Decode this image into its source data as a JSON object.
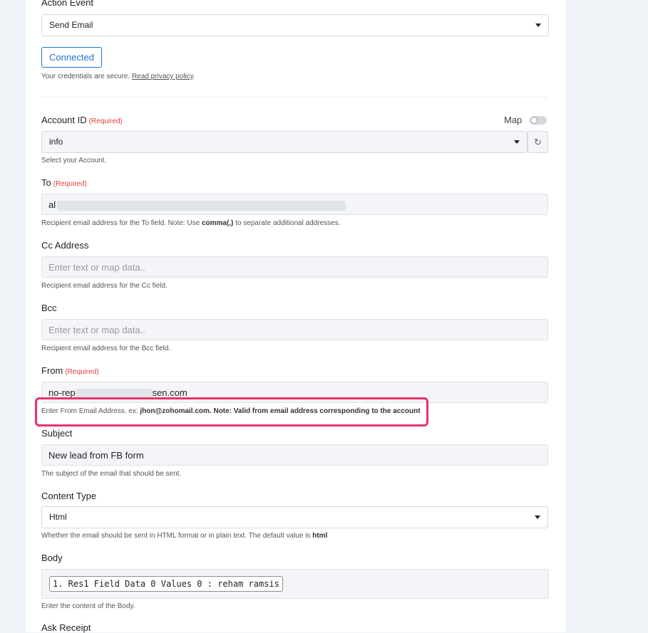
{
  "action_event": {
    "label": "Action Event",
    "value": "Send Email",
    "connected_label": "Connected",
    "credentials_text": "Your credentials are secure.",
    "privacy_link": "Read privacy policy",
    "period": "."
  },
  "account_id": {
    "label": "Account ID",
    "required": "(Required)",
    "map_label": "Map",
    "value": "info",
    "help": "Select your Account."
  },
  "to": {
    "label": "To",
    "required": "(Required)",
    "value": "al",
    "help_prefix": "Recipient email address for the To field. Note: Use",
    "help_bold": "comma(,)",
    "help_suffix": "to separate additional addresses."
  },
  "cc": {
    "label": "Cc Address",
    "placeholder": "Enter text or map data..",
    "help": "Recipient email address for the Cc field."
  },
  "bcc": {
    "label": "Bcc",
    "placeholder": "Enter text or map data..",
    "help": "Recipient email address for the Bcc field."
  },
  "from": {
    "label": "From",
    "required": "(Required)",
    "value_start": "no-rep",
    "value_end": "sen.com",
    "help_prefix": "Enter From Email Address. ex:",
    "help_bold": "jhon@zohomail.com. Note: Valid from email address corresponding to the account"
  },
  "subject": {
    "label": "Subject",
    "value": "New lead from FB form",
    "help": "The subject of the email that should be sent."
  },
  "content_type": {
    "label": "Content Type",
    "value": "Html",
    "help_prefix": "Whether the email should be sent in HTML format or in plain text. The default value is",
    "help_bold": "html"
  },
  "body": {
    "label": "Body",
    "chip": "1. Res1 Field Data 0 Values 0 : reham ramsis",
    "help": "Enter the content of the Body."
  },
  "ask_receipt": {
    "label": "Ask Receipt"
  },
  "colors": {
    "accent": "#1e73d6",
    "required": "#e03e3e",
    "highlight": "#e8336b"
  }
}
